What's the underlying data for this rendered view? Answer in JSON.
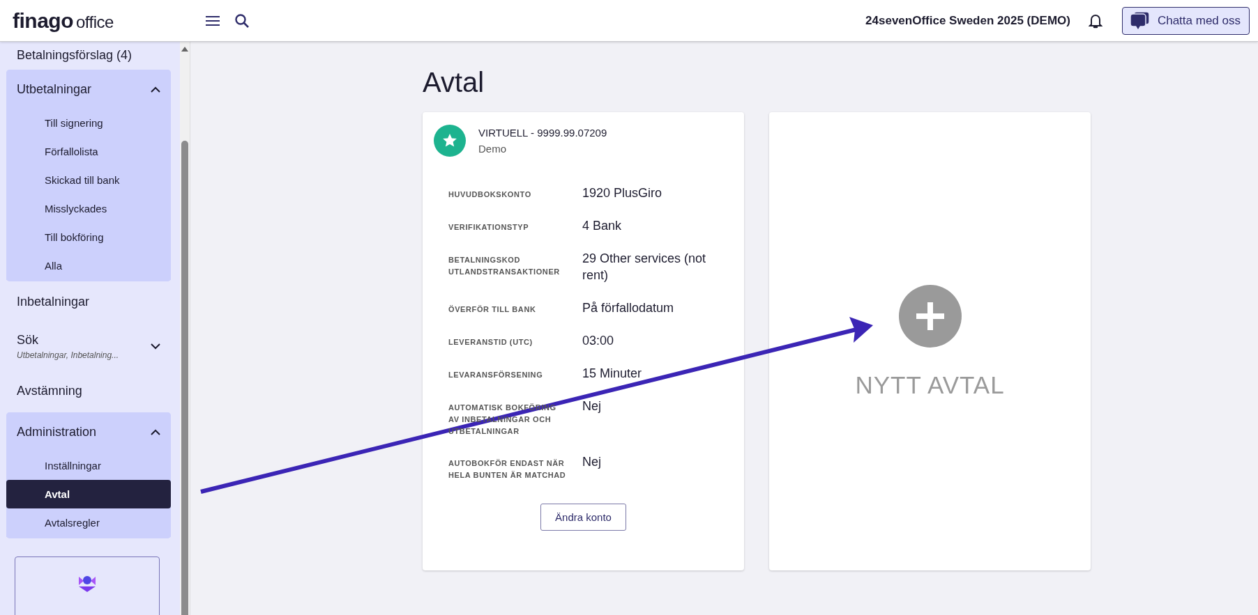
{
  "top_bar": {
    "logo": {
      "brand": "finago",
      "product": "office"
    },
    "company": "24sevenOffice Sweden 2025 (DEMO)",
    "chat_button": "Chatta med oss"
  },
  "sidebar": {
    "items": [
      {
        "kind": "link",
        "label": "Betalningsförslag (4)"
      },
      {
        "kind": "group",
        "label": "Utbetalningar",
        "expanded": true,
        "children": [
          {
            "label": "Till signering",
            "selected": false
          },
          {
            "label": "Förfallolista",
            "selected": false
          },
          {
            "label": "Skickad till bank",
            "selected": false
          },
          {
            "label": "Misslyckades",
            "selected": false
          },
          {
            "label": "Till bokföring",
            "selected": false
          },
          {
            "label": "Alla",
            "selected": false
          }
        ]
      },
      {
        "kind": "link",
        "label": "Inbetalningar"
      },
      {
        "kind": "group",
        "label": "Sök",
        "subtitle": "Utbetalningar, Inbetalning...",
        "expanded": false
      },
      {
        "kind": "link",
        "label": "Avstämning"
      },
      {
        "kind": "group",
        "label": "Administration",
        "expanded": true,
        "children": [
          {
            "label": "Inställningar",
            "selected": false
          },
          {
            "label": "Avtal",
            "selected": true
          },
          {
            "label": "Avtalsregler",
            "selected": false
          }
        ]
      }
    ]
  },
  "page": {
    "title": "Avtal",
    "agreement_card": {
      "title": "VIRTUELL - 9999.99.07209",
      "subtitle": "Demo",
      "fields": [
        {
          "label": "HUVUDBOKSKONTO",
          "value": "1920 PlusGiro"
        },
        {
          "label": "VERIFIKATIONSTYP",
          "value": "4 Bank"
        },
        {
          "label": "BETALNINGSKOD UTLANDSTRANSAKTIONER",
          "value": "29 Other services (not rent)"
        },
        {
          "label": "ÖVERFÖR TILL BANK",
          "value": "På förfallodatum"
        },
        {
          "label": "LEVERANSTID (UTC)",
          "value": "03:00"
        },
        {
          "label": "LEVARANSFÖRSENING",
          "value": "15 Minuter"
        },
        {
          "label": "AUTOMATISK BOKFÖRING AV INBETALNINGAR OCH UTBETALNINGAR",
          "value": "Nej"
        },
        {
          "label": "AUTOBOKFÖR ENDAST NÄR HELA BUNTEN ÄR MATCHAD",
          "value": "Nej"
        }
      ],
      "button": "Ändra konto"
    },
    "new_card": {
      "label": "NYTT AVTAL"
    }
  }
}
